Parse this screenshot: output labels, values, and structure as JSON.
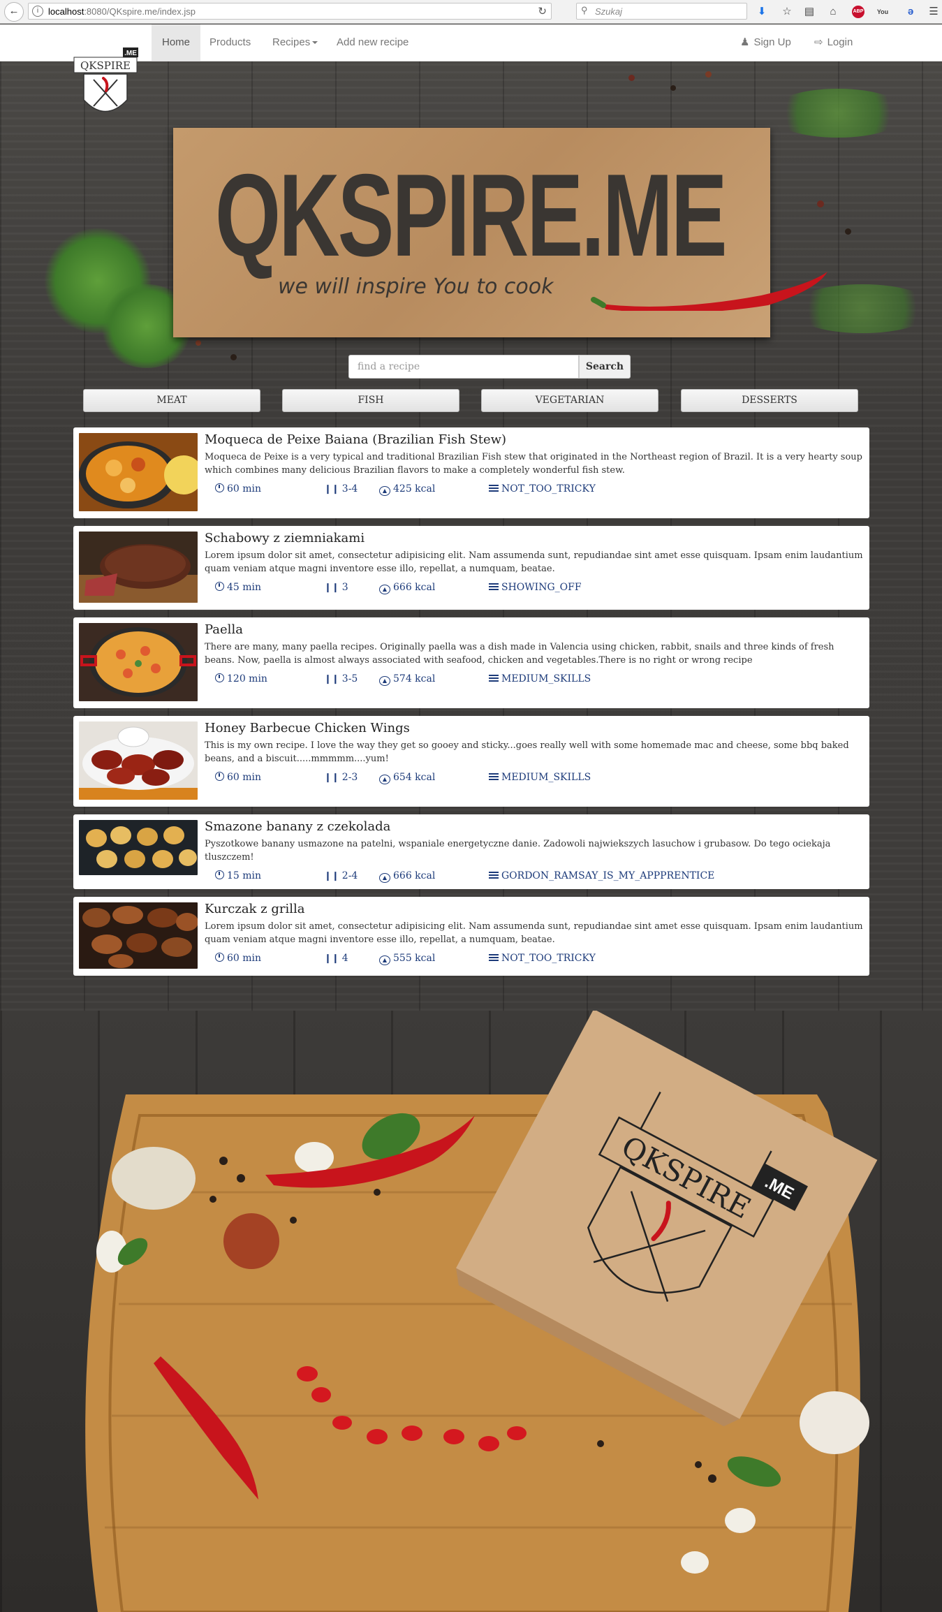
{
  "browser": {
    "url_host": "localhost",
    "url_path": ":8080/QKspire.me/index.jsp",
    "search_placeholder": "Szukaj",
    "abp_label": "ABP",
    "yt_label": "You"
  },
  "nav": {
    "home": "Home",
    "products": "Products",
    "recipes": "Recipes",
    "add_recipe": "Add new recipe",
    "sign_up": "Sign Up",
    "login": "Login"
  },
  "logo": {
    "name": "QKSPIRE",
    "suffix": ".ME"
  },
  "banner": {
    "title": "QKSPIRE.ME",
    "subtitle": "we will inspire You to cook"
  },
  "search": {
    "placeholder": "find a recipe",
    "button": "Search"
  },
  "categories": [
    "MEAT",
    "FISH",
    "VEGETARIAN",
    "DESSERTS"
  ],
  "recipes": [
    {
      "title": "Moqueca de Peixe Baiana (Brazilian Fish Stew)",
      "description": "Moqueca de Peixe is a very typical and traditional Brazilian Fish stew that originated in the Northeast region of Brazil. It is a very hearty soup which combines many delicious Brazilian flavors to make a completely wonderful fish stew.",
      "time": "60 min",
      "servings": "3-4",
      "kcal": "425 kcal",
      "difficulty": "NOT_TOO_TRICKY"
    },
    {
      "title": "Schabowy z ziemniakami",
      "description": "Lorem ipsum dolor sit amet, consectetur adipisicing elit. Nam assumenda sunt, repudiandae sint amet esse quisquam. Ipsam enim laudantium quam veniam atque magni inventore esse illo, repellat, a numquam, beatae.",
      "time": "45 min",
      "servings": "3",
      "kcal": "666 kcal",
      "difficulty": "SHOWING_OFF"
    },
    {
      "title": "Paella",
      "description": "There are many, many paella recipes. Originally paella was a dish made in Valencia using chicken, rabbit, snails and three kinds of fresh beans. Now, paella is almost always associated with seafood, chicken and vegetables.There is no right or wrong recipe",
      "time": "120 min",
      "servings": "3-5",
      "kcal": "574 kcal",
      "difficulty": "MEDIUM_SKILLS"
    },
    {
      "title": "Honey Barbecue Chicken Wings",
      "description": "This is my own recipe. I love the way they get so gooey and sticky...goes really well with some homemade mac and cheese, some bbq baked beans, and a biscuit.....mmmmm....yum!",
      "time": "60 min",
      "servings": "2-3",
      "kcal": "654 kcal",
      "difficulty": "MEDIUM_SKILLS"
    },
    {
      "title": "Smazone banany z czekolada",
      "description": "Pyszotkowe banany usmazone na patelni, wspaniale energetyczne danie. Zadowoli najwiekszych lasuchow i grubasow. Do tego ociekaja tluszczem!",
      "time": "15 min",
      "servings": "2-4",
      "kcal": "666 kcal",
      "difficulty": "GORDON_RAMSAY_IS_MY_APPPRENTICE"
    },
    {
      "title": "Kurczak z grilla",
      "description": "Lorem ipsum dolor sit amet, consectetur adipisicing elit. Nam assumenda sunt, repudiandae sint amet esse quisquam. Ipsam enim laudantium quam veniam atque magni inventore esse illo, repellat, a numquam, beatae.",
      "time": "60 min",
      "servings": "4",
      "kcal": "555 kcal",
      "difficulty": "NOT_TOO_TRICKY"
    }
  ],
  "bottom_box": {
    "name": "QKSPIRE",
    "suffix": ".ME"
  },
  "colors": {
    "meta_text": "#1d3b7a",
    "chili_red": "#c8141c",
    "cardboard": "#c49a6c",
    "wood_dark": "#3d3b39"
  }
}
